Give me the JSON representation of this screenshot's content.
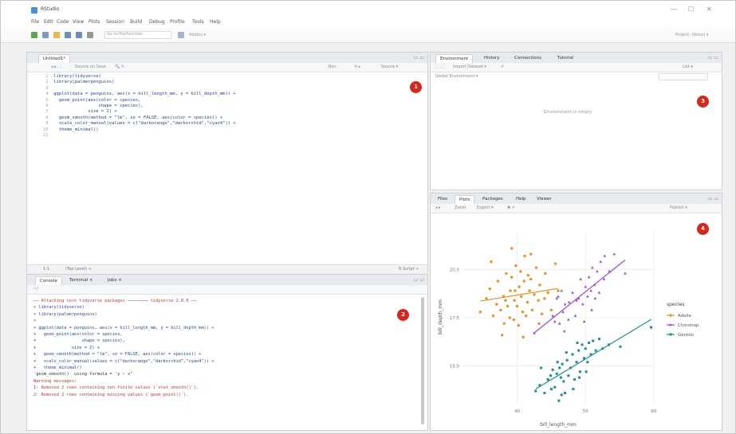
{
  "window": {
    "title": "RStudio",
    "controls": [
      "—",
      "☐",
      "✕"
    ]
  },
  "menubar": {
    "items": [
      "File",
      "Edit",
      "Code",
      "View",
      "Plots",
      "Session",
      "Build",
      "Debug",
      "Profile",
      "Tools",
      "Help"
    ]
  },
  "toolbar": {
    "goto_placeholder": "Go to file/function",
    "addins_label": "Addins ▾",
    "project_label": "Project: (None) ▾"
  },
  "editor": {
    "tab_label": "Untitled1*",
    "toolbar": {
      "source_on_save": "Source on Save",
      "run_label": "Run",
      "source_label": "Source ▾"
    },
    "lines": [
      {
        "n": "1",
        "text": "library(tidyverse)"
      },
      {
        "n": "2",
        "text": "library(palmerpenguins)"
      },
      {
        "n": "3",
        "text": ""
      },
      {
        "n": "4",
        "text": "ggplot(data = penguins, aes(x = bill_length_mm, y = bill_depth_mm)) +"
      },
      {
        "n": "5",
        "text": "  geom_point(aes(color = species,"
      },
      {
        "n": "6",
        "text": "                 shape = species),"
      },
      {
        "n": "7",
        "text": "             size = 2) +"
      },
      {
        "n": "8",
        "text": "  geom_smooth(method = \"lm\", se = FALSE, aes(color = species)) +"
      },
      {
        "n": "9",
        "text": "  scale_color_manual(values = c(\"darkorange\",\"darkorchid\",\"cyan4\")) +"
      },
      {
        "n": "10",
        "text": "  theme_minimal()"
      },
      {
        "n": "11",
        "text": ""
      }
    ],
    "status_left": "1:1",
    "status_mid": "(Top Level) ÷",
    "status_right": "R Script ÷",
    "badge": "1"
  },
  "console": {
    "tabs": [
      "Console",
      "Terminal ×",
      "Jobs ×"
    ],
    "path": "~/",
    "lines": [
      {
        "color": "red",
        "text": "── Attaching core tidyverse packages ──────── tidyverse 2.0.0 ──"
      },
      {
        "color": "blue",
        "text": "> library(tidyverse)"
      },
      {
        "color": "blue",
        "text": "> library(palmerpenguins)"
      },
      {
        "color": "blue",
        "text": ">"
      },
      {
        "color": "blue",
        "text": "> ggplot(data = penguins, aes(x = bill_length_mm, y = bill_depth_mm)) +"
      },
      {
        "color": "blue",
        "text": "+   geom_point(aes(color = species,"
      },
      {
        "color": "blue",
        "text": "+                  shape = species),"
      },
      {
        "color": "blue",
        "text": "+              size = 2) +"
      },
      {
        "color": "blue",
        "text": "+   geom_smooth(method = \"lm\", se = FALSE, aes(color = species)) +"
      },
      {
        "color": "blue",
        "text": "+   scale_color_manual(values = c(\"darkorange\",\"darkorchid\",\"cyan4\")) +"
      },
      {
        "color": "blue",
        "text": "+   theme_minimal()"
      },
      {
        "color": "black",
        "text": "`geom_smooth()` using formula = 'y ~ x'"
      },
      {
        "color": "red",
        "text": "Warning messages:"
      },
      {
        "color": "red",
        "text": "1: Removed 2 rows containing non-finite values (`stat_smooth()`)."
      },
      {
        "color": "red",
        "text": "2: Removed 2 rows containing missing values (`geom_point()`)."
      }
    ],
    "badge": "2"
  },
  "environment": {
    "tabs": [
      "Environment",
      "History",
      "Connections",
      "Tutorial"
    ],
    "import_label": "Import Dataset ▾",
    "list_label": "List ▾",
    "global_env": "Global Environment ▾",
    "empty_msg": "Environment is empty",
    "badge": "3"
  },
  "plots": {
    "tabs": [
      "Files",
      "Plots",
      "Packages",
      "Help",
      "Viewer"
    ],
    "zoom_label": "Zoom",
    "export_label": "Export ▾",
    "publish_label": "Publish ▾",
    "badge": "4"
  },
  "chart_data": {
    "type": "scatter",
    "xlabel": "bill_length_mm",
    "ylabel": "bill_depth_mm",
    "x_ticks": [
      40,
      50,
      60
    ],
    "y_ticks": [
      15.0,
      17.5,
      20.0
    ],
    "xlim": [
      32,
      60
    ],
    "ylim": [
      13,
      22
    ],
    "legend_title": "species",
    "legend_position": "right",
    "series": [
      {
        "name": "Adelie",
        "color": "#f28e1c",
        "points": [
          [
            35.5,
            18.5
          ],
          [
            36,
            19
          ],
          [
            36.5,
            17.6
          ],
          [
            37,
            18.2
          ],
          [
            37.2,
            19.4
          ],
          [
            37.6,
            17.9
          ],
          [
            38,
            18.6
          ],
          [
            38.1,
            17.2
          ],
          [
            38.4,
            19.8
          ],
          [
            38.6,
            18.1
          ],
          [
            38.9,
            17.5
          ],
          [
            39,
            18.9
          ],
          [
            39.2,
            19.6
          ],
          [
            39.5,
            17.4
          ],
          [
            39.6,
            18.4
          ],
          [
            39.8,
            20.2
          ],
          [
            40,
            18.1
          ],
          [
            40.2,
            17.1
          ],
          [
            40.3,
            19.1
          ],
          [
            40.6,
            18.6
          ],
          [
            40.8,
            17.8
          ],
          [
            41,
            19.4
          ],
          [
            41.1,
            20.7
          ],
          [
            41.3,
            17.6
          ],
          [
            41.5,
            18.3
          ],
          [
            41.8,
            18.9
          ],
          [
            42,
            19.5
          ],
          [
            42.2,
            17.9
          ],
          [
            42.5,
            18.7
          ],
          [
            42.8,
            20.1
          ],
          [
            43.1,
            18.4
          ],
          [
            43.3,
            19.2
          ],
          [
            43.6,
            17.7
          ],
          [
            44,
            18.5
          ],
          [
            44.1,
            19.8
          ],
          [
            44.5,
            18.8
          ],
          [
            45,
            17.9
          ],
          [
            45.6,
            20.3
          ],
          [
            46,
            18.9
          ],
          [
            34.6,
            17.8
          ],
          [
            36.2,
            20.4
          ],
          [
            39.2,
            21.1
          ],
          [
            37.8,
            16.6
          ],
          [
            40.9,
            16.5
          ],
          [
            42,
            20.8
          ],
          [
            38.3,
            18.4
          ],
          [
            41.6,
            19.7
          ],
          [
            43.2,
            17.2
          ],
          [
            39.7,
            18.9
          ],
          [
            40.5,
            19.9
          ]
        ]
      },
      {
        "name": "Chinstrap",
        "color": "#9b48d6",
        "points": [
          [
            45.2,
            17.6
          ],
          [
            45.8,
            18.5
          ],
          [
            46.2,
            17.2
          ],
          [
            46.5,
            18.9
          ],
          [
            46.9,
            16.8
          ],
          [
            47,
            18.2
          ],
          [
            47.5,
            17.4
          ],
          [
            48.1,
            18.8
          ],
          [
            48.5,
            17.6
          ],
          [
            49,
            18.5
          ],
          [
            49.3,
            19.5
          ],
          [
            49.6,
            18.2
          ],
          [
            50,
            19.1
          ],
          [
            50.3,
            18.6
          ],
          [
            50.5,
            19.6
          ],
          [
            50.8,
            18.9
          ],
          [
            51,
            20.1
          ],
          [
            51.3,
            19.2
          ],
          [
            51.7,
            19.9
          ],
          [
            52,
            18.8
          ],
          [
            52.2,
            20.4
          ],
          [
            52.7,
            19.5
          ],
          [
            53.5,
            19.9
          ],
          [
            54.2,
            20.8
          ],
          [
            55.8,
            19.8
          ],
          [
            46,
            18.6
          ],
          [
            47.6,
            18.3
          ],
          [
            48.7,
            18.4
          ],
          [
            49.8,
            17.3
          ],
          [
            50.9,
            17.9
          ],
          [
            51.4,
            18.5
          ],
          [
            45.5,
            17.3
          ],
          [
            46.7,
            17.8
          ],
          [
            42.5,
            16.7
          ],
          [
            52.8,
            20.7
          ]
        ]
      },
      {
        "name": "Gentoo",
        "color": "#17918c",
        "points": [
          [
            42.7,
            13.7
          ],
          [
            43.3,
            14
          ],
          [
            44,
            13.6
          ],
          [
            44.5,
            14.3
          ],
          [
            45,
            13.8
          ],
          [
            45.2,
            14.8
          ],
          [
            45.5,
            13.9
          ],
          [
            45.8,
            14.6
          ],
          [
            46.1,
            13.2
          ],
          [
            46.4,
            14.4
          ],
          [
            46.6,
            15.1
          ],
          [
            46.8,
            14.2
          ],
          [
            47,
            13.6
          ],
          [
            47.3,
            15.3
          ],
          [
            47.5,
            14.5
          ],
          [
            47.8,
            14.9
          ],
          [
            48.1,
            15.6
          ],
          [
            48.4,
            14.3
          ],
          [
            48.7,
            15.2
          ],
          [
            49,
            15.8
          ],
          [
            49.2,
            14.7
          ],
          [
            49.5,
            16.1
          ],
          [
            49.8,
            15.4
          ],
          [
            50,
            15.9
          ],
          [
            50.3,
            15.2
          ],
          [
            50.5,
            16.2
          ],
          [
            50.8,
            15.6
          ],
          [
            51.1,
            16.3
          ],
          [
            51.5,
            15.8
          ],
          [
            52,
            16.4
          ],
          [
            52.5,
            15.9
          ],
          [
            53.4,
            16.1
          ],
          [
            55.1,
            16
          ],
          [
            59.6,
            17
          ],
          [
            44.9,
            14.5
          ],
          [
            45.9,
            15.2
          ],
          [
            46.2,
            14.9
          ],
          [
            47.2,
            15.7
          ],
          [
            48.2,
            13.8
          ],
          [
            49.1,
            14.4
          ],
          [
            50.1,
            14.7
          ],
          [
            46.5,
            13.5
          ],
          [
            43.5,
            14.9
          ],
          [
            48.8,
            16.2
          ]
        ]
      }
    ]
  }
}
